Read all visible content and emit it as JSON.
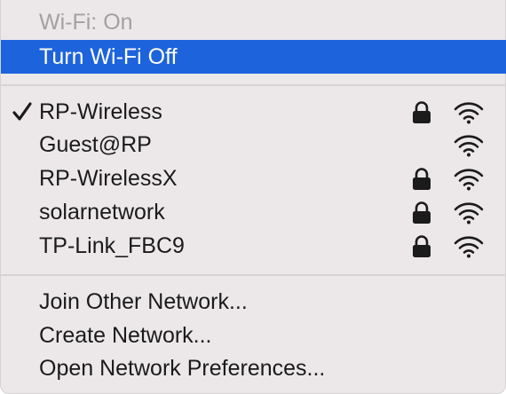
{
  "menu": {
    "status_label": "Wi-Fi: On",
    "toggle_label": "Turn Wi-Fi Off",
    "networks": [
      {
        "name": "RP-Wireless",
        "connected": true,
        "secured": true,
        "signal_bars": 3
      },
      {
        "name": "Guest@RP",
        "connected": false,
        "secured": false,
        "signal_bars": 3
      },
      {
        "name": "RP-WirelessX",
        "connected": false,
        "secured": true,
        "signal_bars": 3
      },
      {
        "name": "solarnetwork",
        "connected": false,
        "secured": true,
        "signal_bars": 3
      },
      {
        "name": "TP-Link_FBC9",
        "connected": false,
        "secured": true,
        "signal_bars": 3
      }
    ],
    "actions": {
      "join_other": "Join Other Network...",
      "create": "Create Network...",
      "open_prefs": "Open Network Preferences..."
    }
  },
  "colors": {
    "menu_background": "#ece8ea",
    "highlight": "#1d63dc",
    "text": "#1b1b1b",
    "disabled_text": "#a3a0a2",
    "separator": "#d7d3d5"
  },
  "icons": {
    "checkmark": "checkmark-icon",
    "lock": "lock-icon",
    "wifi": "wifi-signal-icon"
  }
}
